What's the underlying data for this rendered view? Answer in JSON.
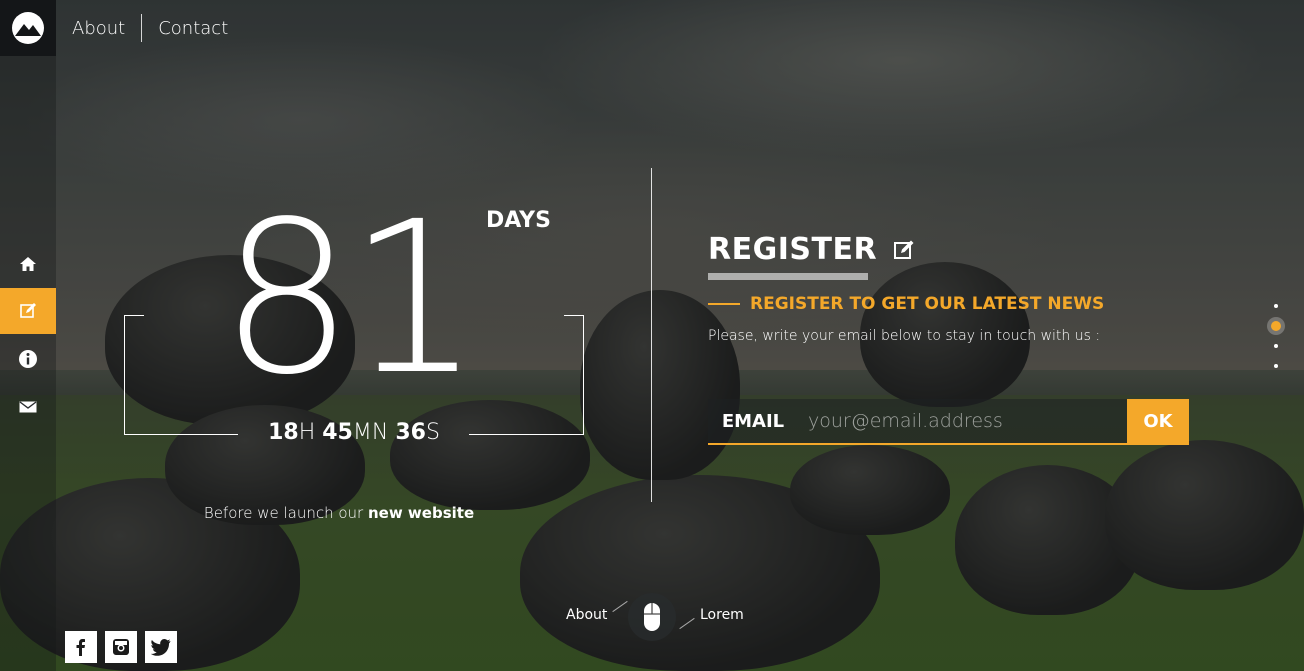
{
  "nav": {
    "about": "About",
    "contact": "Contact"
  },
  "sidebar": {
    "items": [
      {
        "icon": "home-icon"
      },
      {
        "icon": "edit-icon",
        "active": true
      },
      {
        "icon": "info-icon"
      },
      {
        "icon": "mail-icon"
      }
    ]
  },
  "countdown": {
    "days": "81",
    "days_label": "DAYS",
    "hours": "18",
    "hours_unit": "H",
    "minutes": "45",
    "minutes_unit": "MN",
    "seconds": "36",
    "seconds_unit": "S",
    "tagline_prefix": "Before we launch our ",
    "tagline_bold": "new website"
  },
  "register": {
    "title": "REGISTER",
    "subtitle": "REGISTER TO GET OUR LATEST NEWS",
    "description": "Please, write your email below to stay in touch with us :",
    "email_label": "EMAIL",
    "email_placeholder": "your@email.address",
    "submit_label": "OK"
  },
  "bottom": {
    "left_link": "About",
    "right_link": "Lorem"
  },
  "social": [
    "facebook-icon",
    "instagram-icon",
    "twitter-icon"
  ],
  "colors": {
    "accent": "#f4a82a"
  }
}
